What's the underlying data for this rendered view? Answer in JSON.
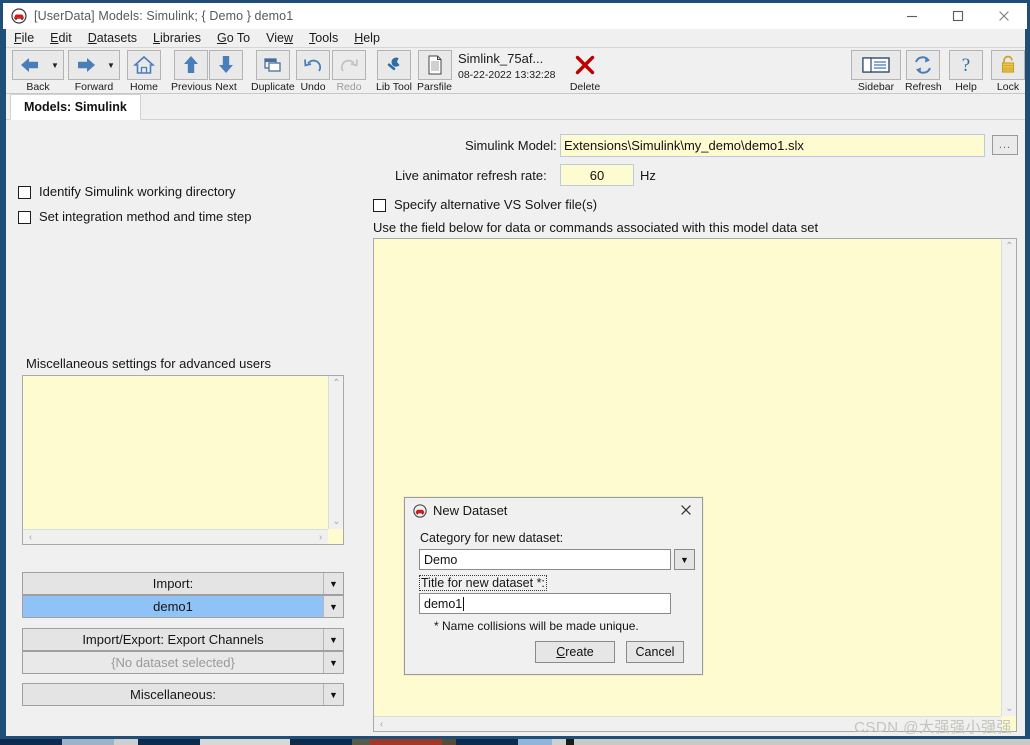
{
  "window": {
    "title": "[UserData] Models: Simulink; { Demo } demo1",
    "icon": "car-icon",
    "minimize_label": "—",
    "maximize_label": "□",
    "close_label": "✕"
  },
  "menu": {
    "items": [
      {
        "label": "File",
        "mnemonic": "F"
      },
      {
        "label": "Edit",
        "mnemonic": "E"
      },
      {
        "label": "Datasets",
        "mnemonic": "D"
      },
      {
        "label": "Libraries",
        "mnemonic": "L"
      },
      {
        "label": "Go To",
        "mnemonic": "G"
      },
      {
        "label": "View",
        "mnemonic": "w"
      },
      {
        "label": "Tools",
        "mnemonic": "T"
      },
      {
        "label": "Help",
        "mnemonic": "H"
      }
    ]
  },
  "toolbar": {
    "buttons": [
      {
        "name": "back",
        "label": "Back",
        "icon": "arrow-left-icon",
        "has_dropdown": true,
        "disabled": false
      },
      {
        "name": "forward",
        "label": "Forward",
        "icon": "arrow-right-icon",
        "has_dropdown": true,
        "disabled": false
      },
      {
        "name": "home",
        "label": "Home",
        "icon": "home-icon",
        "has_dropdown": false,
        "disabled": false
      },
      {
        "name": "previous",
        "label": "Previous",
        "icon": "arrow-up-icon",
        "has_dropdown": false,
        "disabled": false
      },
      {
        "name": "next",
        "label": "Next",
        "icon": "arrow-down-icon",
        "has_dropdown": false,
        "disabled": false
      },
      {
        "name": "duplicate",
        "label": "Duplicate",
        "icon": "duplicate-icon",
        "has_dropdown": false,
        "disabled": false
      },
      {
        "name": "undo",
        "label": "Undo",
        "icon": "undo-icon",
        "has_dropdown": false,
        "disabled": false
      },
      {
        "name": "redo",
        "label": "Redo",
        "icon": "redo-icon",
        "has_dropdown": false,
        "disabled": true
      },
      {
        "name": "lib-tool",
        "label": "Lib Tool",
        "icon": "wrench-icon",
        "has_dropdown": false,
        "disabled": false
      },
      {
        "name": "parsfile",
        "label": "Parsfile",
        "icon": "document-icon",
        "has_dropdown": false,
        "disabled": false
      },
      {
        "name": "delete",
        "label": "Delete",
        "icon": "red-x-icon",
        "has_dropdown": false,
        "disabled": false
      }
    ],
    "parsfile_info": {
      "name": "Simlink_75af...",
      "timestamp": "08-22-2022 13:32:28"
    },
    "right_buttons": [
      {
        "name": "sidebar",
        "label": "Sidebar",
        "icon": "sidebar-icon"
      },
      {
        "name": "refresh",
        "label": "Refresh",
        "icon": "refresh-icon"
      },
      {
        "name": "help",
        "label": "Help",
        "icon": "question-mark-icon"
      },
      {
        "name": "lock",
        "label": "Lock",
        "icon": "padlock-icon"
      }
    ]
  },
  "tab": {
    "label": "Models: Simulink"
  },
  "left_panel": {
    "checkbox_identify_dir": {
      "label": "Identify Simulink working directory",
      "checked": false
    },
    "checkbox_integration": {
      "label": "Set integration method and time step",
      "checked": false
    },
    "misc_settings_label": "Miscellaneous settings for advanced users",
    "misc_settings_value": "",
    "combos": [
      {
        "name": "import",
        "label": "Import:",
        "selected": false,
        "dim": false
      },
      {
        "name": "import-dataset",
        "label": "demo1",
        "selected": true,
        "dim": false
      },
      {
        "name": "import-export",
        "label": "Import/Export: Export Channels",
        "selected": false,
        "dim": false
      },
      {
        "name": "export-dataset",
        "label": "{No dataset selected}",
        "selected": false,
        "dim": true
      },
      {
        "name": "miscellaneous",
        "label": "Miscellaneous:",
        "selected": false,
        "dim": false
      }
    ]
  },
  "right_panel": {
    "simulink_model_label": "Simulink Model:",
    "simulink_model_value": "Extensions\\Simulink\\my_demo\\demo1.slx",
    "browse_button_label": "...",
    "refresh_rate_label": "Live animator refresh rate:",
    "refresh_rate_value": "60",
    "refresh_rate_unit": "Hz",
    "checkbox_vs_solver": {
      "label": "Specify alternative VS Solver file(s)",
      "checked": false
    },
    "memo_hint": "Use the field below  for data or commands associated with this model data set",
    "memo_value": ""
  },
  "dialog": {
    "icon": "car-icon",
    "title": "New Dataset",
    "close_label": "✕",
    "category_label": "Category for new dataset:",
    "category_value": "Demo",
    "title_label": "Title for new dataset *:",
    "title_value": "demo1",
    "note": "* Name collisions will be made unique.",
    "create_button": "Create",
    "create_mnemonic": "C",
    "cancel_button": "Cancel"
  },
  "watermark": "CSDN @大强强小强强",
  "colors": {
    "frame_blue": "#1f4e79",
    "field_yellow": "#fdfbcf",
    "selection_blue": "#8fc3f7",
    "chrome_gray": "#f0f0f0",
    "accent_red": "#c00000"
  }
}
